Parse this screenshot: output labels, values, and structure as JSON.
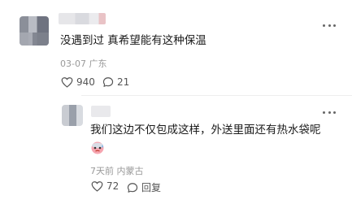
{
  "comments": [
    {
      "text": "没遇到过 真希望能有这种保温",
      "date": "03-07",
      "location": "广东",
      "likes": "940",
      "replies": "21"
    },
    {
      "text": "我们这边不仅包成这样，外送里面还有热水袋呢",
      "emoji": "sweating-face-emoji",
      "date": "7天前",
      "location": "内蒙古",
      "likes": "72",
      "reply_label": "回复"
    }
  ]
}
